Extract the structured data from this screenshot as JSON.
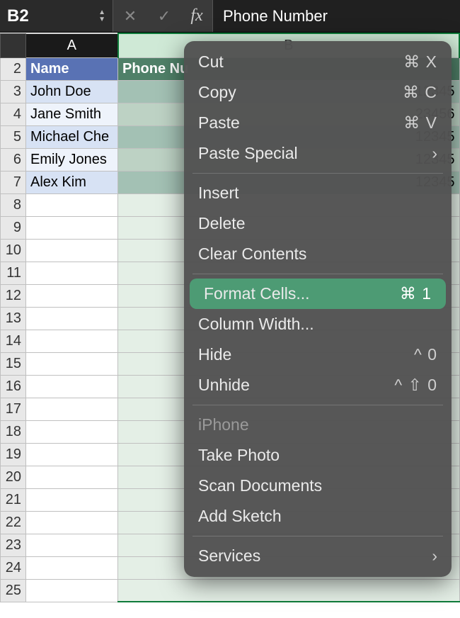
{
  "formula_bar": {
    "cell_ref": "B2",
    "formula_value": "Phone Number",
    "fx_label": "fx"
  },
  "columns": {
    "A": "A",
    "B": "B"
  },
  "rows": {
    "header": {
      "name": "Name",
      "phone": "Phone Nu"
    },
    "data": [
      {
        "row": "3",
        "name": "John Doe",
        "phone": "12345"
      },
      {
        "row": "4",
        "name": "Jane Smith",
        "phone": "23456"
      },
      {
        "row": "5",
        "name": "Michael Che",
        "phone": "12345"
      },
      {
        "row": "6",
        "name": "Emily Jones",
        "phone": "12345"
      },
      {
        "row": "7",
        "name": "Alex Kim",
        "phone": "12345"
      }
    ],
    "empty_rows": [
      "8",
      "9",
      "10",
      "11",
      "12",
      "13",
      "14",
      "15",
      "16",
      "17",
      "18",
      "19",
      "20",
      "21",
      "22",
      "23",
      "24",
      "25"
    ]
  },
  "context_menu": {
    "cut": {
      "label": "Cut",
      "shortcut": "⌘ X"
    },
    "copy": {
      "label": "Copy",
      "shortcut": "⌘ C"
    },
    "paste": {
      "label": "Paste",
      "shortcut": "⌘ V"
    },
    "paste_special": {
      "label": "Paste Special",
      "submenu": true
    },
    "insert": {
      "label": "Insert"
    },
    "delete": {
      "label": "Delete"
    },
    "clear": {
      "label": "Clear Contents"
    },
    "format_cells": {
      "label": "Format Cells...",
      "shortcut": "⌘ 1"
    },
    "column_width": {
      "label": "Column Width..."
    },
    "hide": {
      "label": "Hide",
      "shortcut": "^ 0"
    },
    "unhide": {
      "label": "Unhide",
      "shortcut": "^ ⇧ 0"
    },
    "iphone": {
      "label": "iPhone"
    },
    "take_photo": {
      "label": "Take Photo"
    },
    "scan_documents": {
      "label": "Scan Documents"
    },
    "add_sketch": {
      "label": "Add Sketch"
    },
    "services": {
      "label": "Services",
      "submenu": true
    }
  }
}
